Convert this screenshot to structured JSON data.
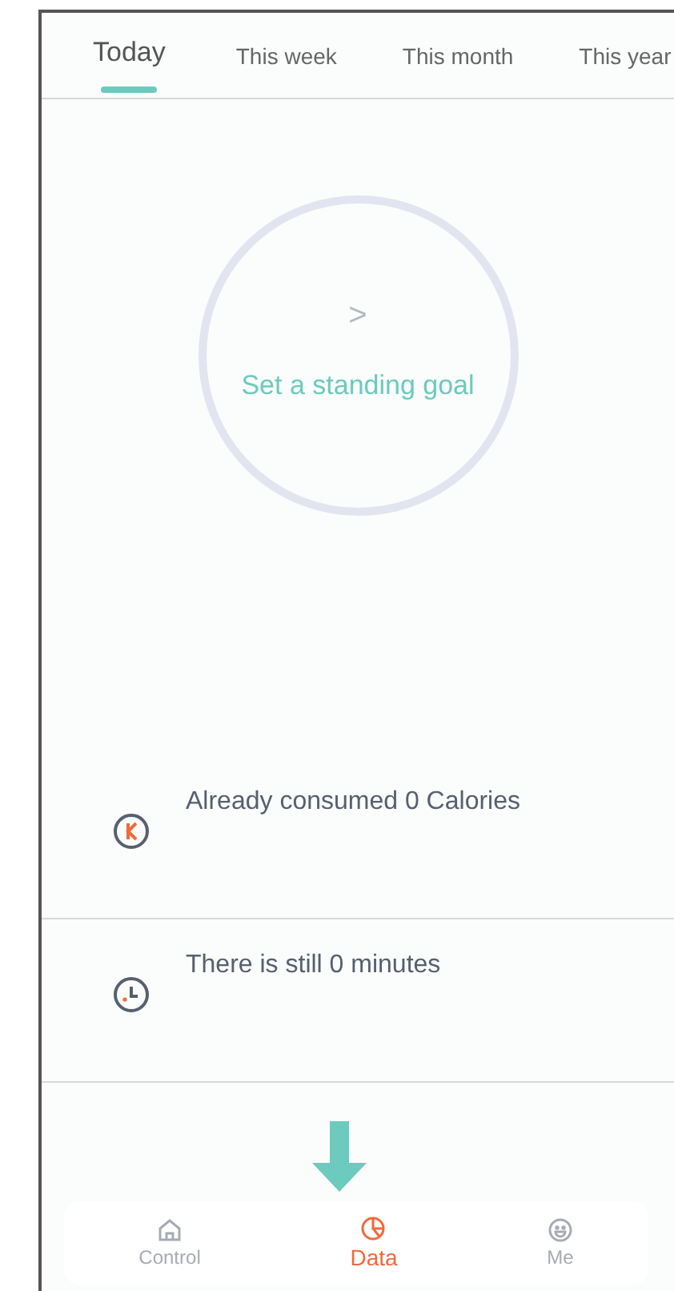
{
  "tabs": [
    {
      "label": "Today",
      "selected": true
    },
    {
      "label": "This week",
      "selected": false
    },
    {
      "label": "This month",
      "selected": false
    },
    {
      "label": "This year",
      "selected": false
    }
  ],
  "goal": {
    "chevron": ">",
    "label": "Set a standing goal"
  },
  "stats": [
    {
      "kind": "calories",
      "text": "Already consumed 0 Calories"
    },
    {
      "kind": "time",
      "text": "There is still 0 minutes"
    }
  ],
  "nav": [
    {
      "kind": "home",
      "label": "Control",
      "selected": false
    },
    {
      "kind": "chart",
      "label": "Data",
      "selected": true
    },
    {
      "kind": "face",
      "label": "Me",
      "selected": false
    }
  ]
}
